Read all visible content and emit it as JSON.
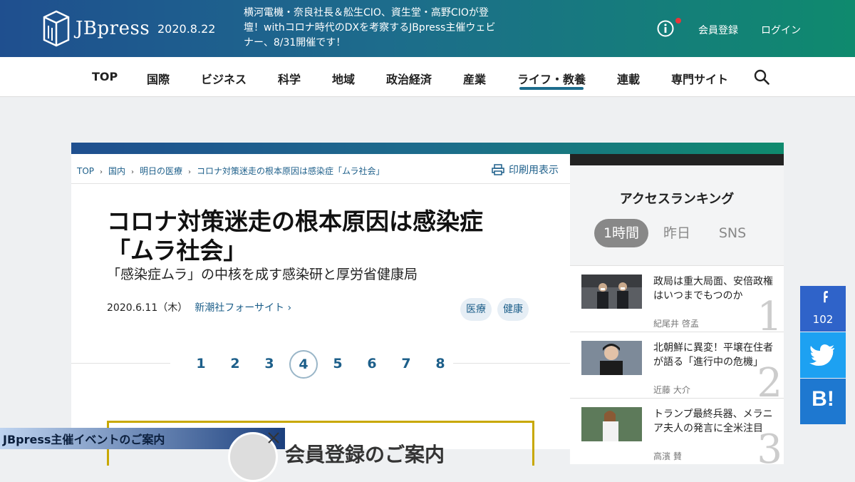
{
  "header": {
    "logo_text": "JBpress",
    "date": "2020.8.22",
    "news": "横河電機・奈良社長＆舩生CIO、資生堂・高野CIOが登壇！withコロナ時代のDXを考察するJBpress主催ウェビナー、8/31開催です！",
    "register": "会員登録",
    "login": "ログイン"
  },
  "nav": {
    "items": [
      "TOP",
      "国際",
      "ビジネス",
      "科学",
      "地域",
      "政治経済",
      "産業",
      "ライフ・教養",
      "連載",
      "専門サイト"
    ],
    "active": "ライフ・教養"
  },
  "breadcrumb": [
    "TOP",
    "国内",
    "明日の医療",
    "コロナ対策迷走の根本原因は感染症「ムラ社会」"
  ],
  "print_label": "印刷用表示",
  "article": {
    "title_line1": "コロナ対策迷走の根本原因は感染症",
    "title_line2": "「ムラ社会」",
    "subtitle": "「感染症ムラ」の中核を成す感染研と厚労省健康局",
    "date": "2020.6.11（木）",
    "author": "新潮社フォーサイト",
    "author_arrow": "›",
    "tags": [
      "医療",
      "健康"
    ],
    "pages": [
      "1",
      "2",
      "3",
      "4",
      "5",
      "6",
      "7",
      "8"
    ],
    "current_page": "4",
    "ad_text": "会員登録のご案内"
  },
  "sidebar": {
    "title": "アクセスランキング",
    "tabs": [
      "1時間",
      "昨日",
      "SNS"
    ],
    "active_tab": "1時間",
    "ranking": [
      {
        "rank": "1",
        "title": "政局は重大局面、安倍政権はいつまでもつのか",
        "author": "紀尾井 啓孟"
      },
      {
        "rank": "2",
        "title": "北朝鮮に異変！平壌在住者が語る「進行中の危機」",
        "author": "近藤 大介"
      },
      {
        "rank": "3",
        "title": "トランプ最終兵器、メラニア夫人の発言に全米注目",
        "author": "高濱 賛"
      }
    ]
  },
  "social": {
    "facebook_count": "102",
    "hatena_label": "B!"
  },
  "event_banner": "JBpress主催イベントのご案内",
  "colors": {
    "brand_blue": "#1f4f8f",
    "brand_green": "#0f8a6e",
    "link": "#1d5f8a",
    "facebook": "#2f63c9",
    "twitter": "#1da1f2",
    "hatena": "#1e78d0"
  },
  "icons": [
    "logo-cube-icon",
    "info-icon",
    "search-icon",
    "print-icon",
    "facebook-icon",
    "twitter-icon",
    "close-icon"
  ]
}
